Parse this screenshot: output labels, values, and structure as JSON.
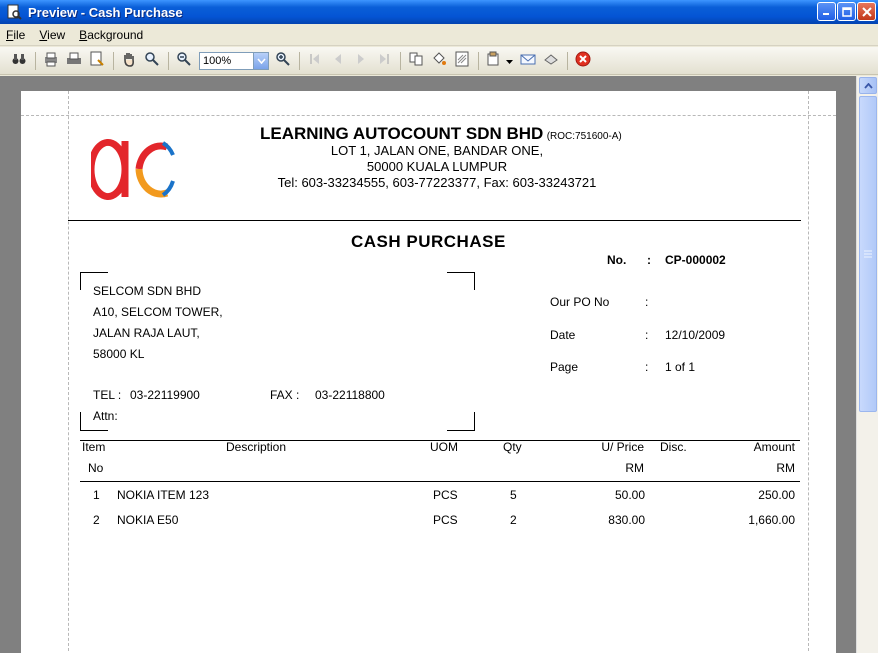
{
  "window": {
    "title": "Preview - Cash Purchase"
  },
  "menu": {
    "items": [
      "File",
      "View",
      "Background"
    ]
  },
  "toolbar": {
    "zoom_value": "100%"
  },
  "company": {
    "name": "LEARNING AUTOCOUNT SDN BHD",
    "reg": "(ROC:751600-A)",
    "address_line1": "LOT 1, JALAN ONE,  BANDAR ONE,",
    "address_line2": "50000  KUALA LUMPUR",
    "contact": "Tel: 603-33234555,  603-77223377,  Fax: 603-33243721",
    "logo_colors": {
      "red": "#e3262b",
      "orange": "#f29a1e",
      "blue": "#1a73c9"
    }
  },
  "document": {
    "title": "CASH  PURCHASE",
    "no_label": "No.",
    "no_colon": ":",
    "no_value": "CP-000002",
    "po_label": "Our PO No",
    "po_colon": ":",
    "po_value": "",
    "date_label": "Date",
    "date_colon": ":",
    "date_value": "12/10/2009",
    "page_label": "Page",
    "page_colon": ":",
    "page_value": "1 of 1"
  },
  "supplier": {
    "name": "SELCOM SDN BHD",
    "address_line1": "A10, SELCOM TOWER,",
    "address_line2": "JALAN RAJA LAUT,",
    "address_line3": "58000 KL",
    "tel_label": "TEL :",
    "tel_value": "03-22119900",
    "fax_label": "FAX :",
    "fax_value": "03-22118800",
    "attn_label": "Attn:"
  },
  "table": {
    "headers": {
      "item": "Item",
      "item2": "No",
      "description": "Description",
      "uom": "UOM",
      "qty": "Qty",
      "price": "U/ Price",
      "price2": "RM",
      "disc": "Disc.",
      "amount": "Amount",
      "amount2": "RM"
    },
    "rows": [
      {
        "no": "1",
        "description": "NOKIA ITEM 123",
        "uom": "PCS",
        "qty": "5",
        "price": "50.00",
        "disc": "",
        "amount": "250.00"
      },
      {
        "no": "2",
        "description": "NOKIA E50",
        "uom": "PCS",
        "qty": "2",
        "price": "830.00",
        "disc": "",
        "amount": "1,660.00"
      }
    ]
  }
}
